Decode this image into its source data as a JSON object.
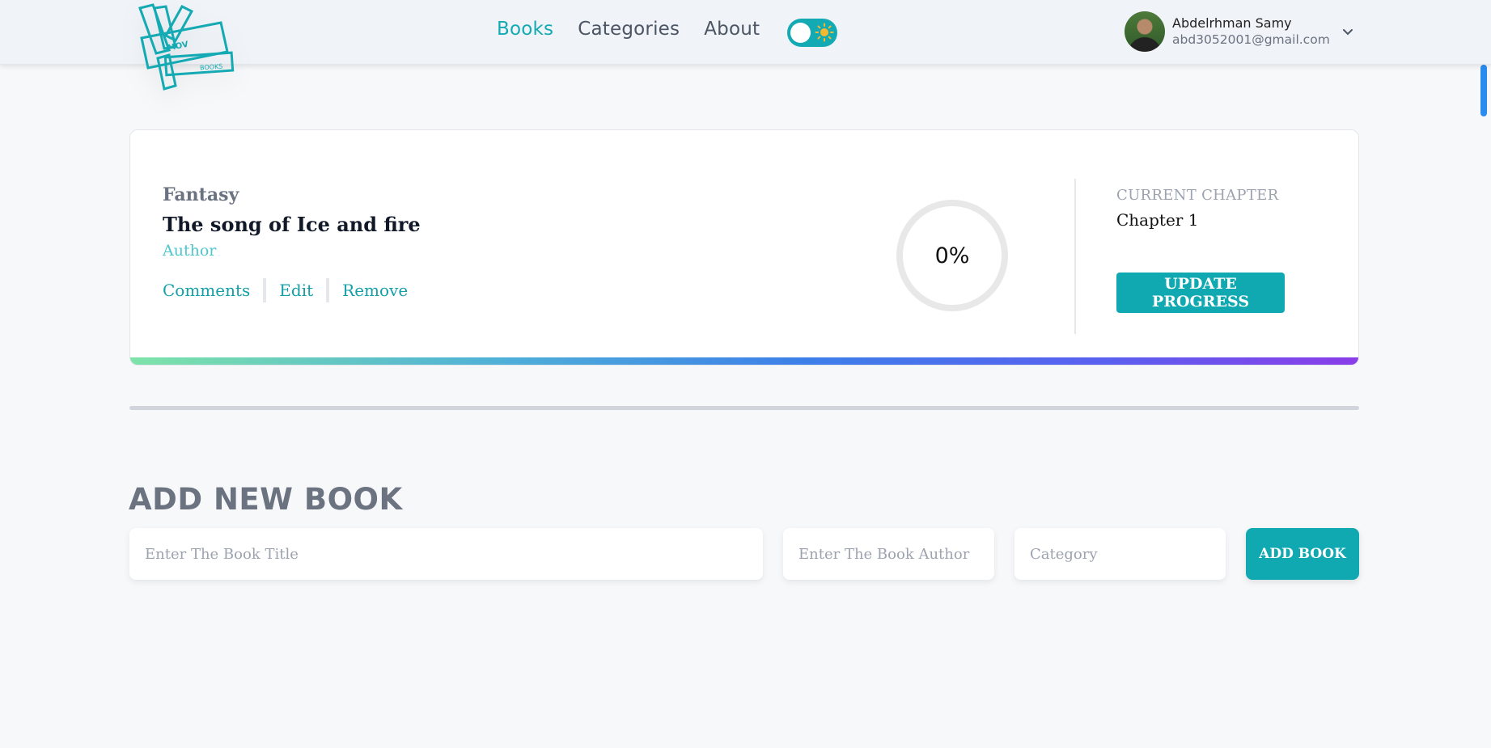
{
  "header": {
    "logo": {
      "line1": "MOV",
      "line2": "BOOKS",
      "color": "#14aab3"
    },
    "nav": [
      {
        "label": "Books",
        "active": true
      },
      {
        "label": "Categories",
        "active": false
      },
      {
        "label": "About",
        "active": false
      }
    ],
    "theme_toggle": {
      "state": "light",
      "icon": "sun-icon",
      "accent": "#14aab3"
    },
    "user": {
      "name": "Abdelrhman Samy",
      "email": "abd3052001@gmail.com",
      "dropdown_icon": "chevron-down-icon"
    }
  },
  "book": {
    "category": "Fantasy",
    "title": "The song of Ice and fire",
    "author": "Author",
    "actions": {
      "comments": "Comments",
      "edit": "Edit",
      "remove": "Remove"
    },
    "progress_percent": 0,
    "progress_label": "0%",
    "current_chapter_label": "CURRENT CHAPTER",
    "current_chapter_value": "Chapter 1",
    "update_button": "UPDATE PROGRESS"
  },
  "add_book": {
    "heading": "ADD NEW BOOK",
    "title_placeholder": "Enter The Book Title",
    "author_placeholder": "Enter The Book Author",
    "category_placeholder": "Category",
    "button": "ADD BOOK"
  },
  "colors": {
    "accent": "#14aab3",
    "gradient": [
      "#7ee3a9",
      "#3d7fe9",
      "#8a3de9"
    ]
  }
}
